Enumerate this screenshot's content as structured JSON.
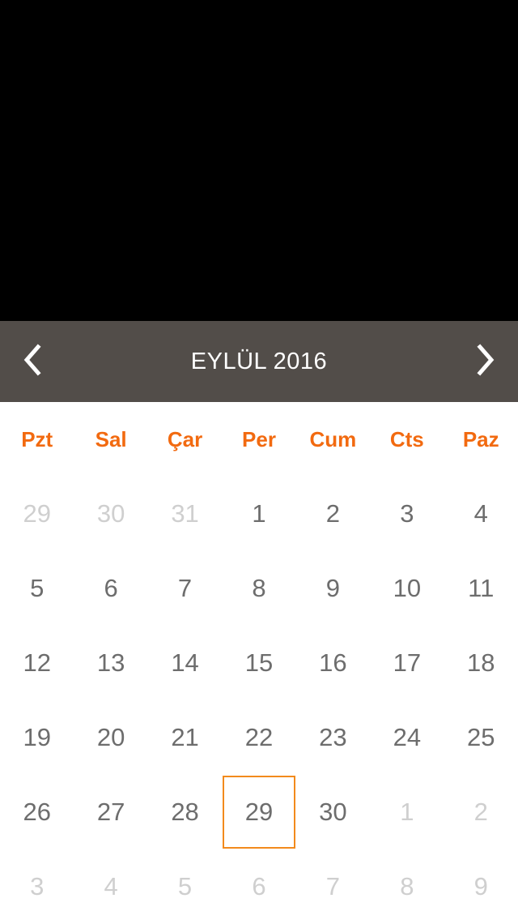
{
  "header": {
    "title": "EYLÜL 2016",
    "prev_icon": "chevron-left-icon",
    "next_icon": "chevron-right-icon"
  },
  "colors": {
    "header_bg": "#524d49",
    "weekday_text": "#f26a10",
    "selected_border": "#f28a1c",
    "day_text": "#6d6d6d",
    "muted_text": "#cfcfcf"
  },
  "weekdays": [
    "Pzt",
    "Sal",
    "Çar",
    "Per",
    "Cum",
    "Cts",
    "Paz"
  ],
  "weeks": [
    [
      {
        "d": "29",
        "m": true
      },
      {
        "d": "30",
        "m": true
      },
      {
        "d": "31",
        "m": true
      },
      {
        "d": "1"
      },
      {
        "d": "2"
      },
      {
        "d": "3"
      },
      {
        "d": "4"
      }
    ],
    [
      {
        "d": "5"
      },
      {
        "d": "6"
      },
      {
        "d": "7"
      },
      {
        "d": "8"
      },
      {
        "d": "9"
      },
      {
        "d": "10"
      },
      {
        "d": "11"
      }
    ],
    [
      {
        "d": "12"
      },
      {
        "d": "13"
      },
      {
        "d": "14"
      },
      {
        "d": "15"
      },
      {
        "d": "16"
      },
      {
        "d": "17"
      },
      {
        "d": "18"
      }
    ],
    [
      {
        "d": "19"
      },
      {
        "d": "20"
      },
      {
        "d": "21"
      },
      {
        "d": "22"
      },
      {
        "d": "23"
      },
      {
        "d": "24"
      },
      {
        "d": "25"
      }
    ],
    [
      {
        "d": "26"
      },
      {
        "d": "27"
      },
      {
        "d": "28"
      },
      {
        "d": "29",
        "s": true
      },
      {
        "d": "30"
      },
      {
        "d": "1",
        "m": true
      },
      {
        "d": "2",
        "m": true
      }
    ],
    [
      {
        "d": "3",
        "m": true
      },
      {
        "d": "4",
        "m": true
      },
      {
        "d": "5",
        "m": true
      },
      {
        "d": "6",
        "m": true
      },
      {
        "d": "7",
        "m": true
      },
      {
        "d": "8",
        "m": true
      },
      {
        "d": "9",
        "m": true
      }
    ]
  ]
}
